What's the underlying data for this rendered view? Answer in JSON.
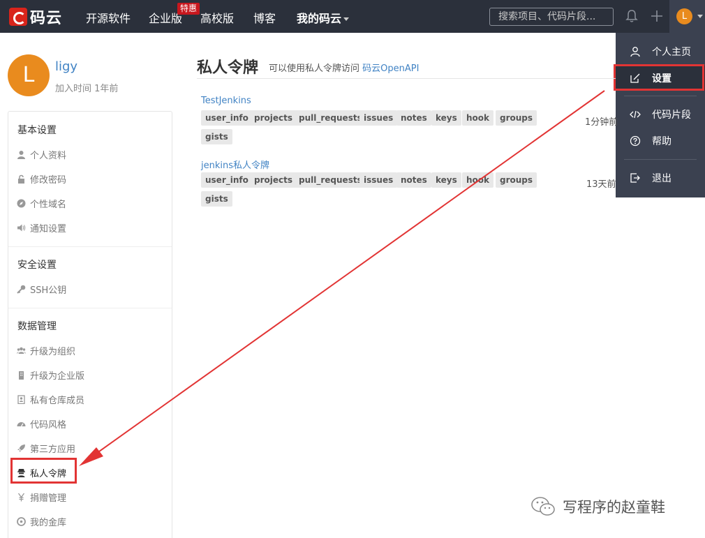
{
  "topnav": {
    "brand": "码云",
    "items": [
      {
        "label": "开源软件"
      },
      {
        "label": "企业版"
      },
      {
        "label": "高校版"
      },
      {
        "label": "博客"
      },
      {
        "label": "我的码云"
      }
    ],
    "badge": "特惠",
    "search_placeholder": "搜索项目、代码片段...",
    "avatar_letter": "L"
  },
  "dropdown": {
    "items": [
      {
        "label": "个人主页",
        "icon": "user-icon"
      },
      {
        "label": "设置",
        "icon": "edit-icon"
      },
      {
        "label": "代码片段",
        "icon": "code-icon"
      },
      {
        "label": "帮助",
        "icon": "help-icon"
      },
      {
        "label": "退出",
        "icon": "logout-icon"
      }
    ]
  },
  "profile": {
    "avatar_letter": "L",
    "name": "ligy",
    "joined": "加入时间 1年前"
  },
  "sidebar": {
    "sections": [
      {
        "heading": "基本设置",
        "items": [
          "个人资料",
          "修改密码",
          "个性域名",
          "通知设置"
        ]
      },
      {
        "heading": "安全设置",
        "items": [
          "SSH公钥"
        ]
      },
      {
        "heading": "数据管理",
        "items": [
          "升级为组织",
          "升级为企业版",
          "私有仓库成员",
          "代码风格",
          "第三方应用",
          "私人令牌",
          "捐赠管理",
          "我的金库"
        ]
      }
    ]
  },
  "main": {
    "title": "私人令牌",
    "subtitle": "可以使用私人令牌访问",
    "subtitle_link": "码云OpenAPI",
    "tokens": [
      {
        "name": "TestJenkins",
        "scopes": [
          "user_info",
          "projects",
          "pull_requests",
          "issues",
          "notes",
          "keys",
          "hook",
          "groups",
          "gists"
        ],
        "time": "1分钟前"
      },
      {
        "name": "jenkins私人令牌",
        "scopes": [
          "user_info",
          "projects",
          "pull_requests",
          "issues",
          "notes",
          "keys",
          "hook",
          "groups",
          "gists"
        ],
        "time": "13天前"
      }
    ]
  },
  "watermark": {
    "text": "写程序的赵童鞋"
  },
  "colors": {
    "nav_bg": "#2b303b",
    "accent_red": "#e23434",
    "link": "#4183c4",
    "avatar": "#e98b1e"
  }
}
